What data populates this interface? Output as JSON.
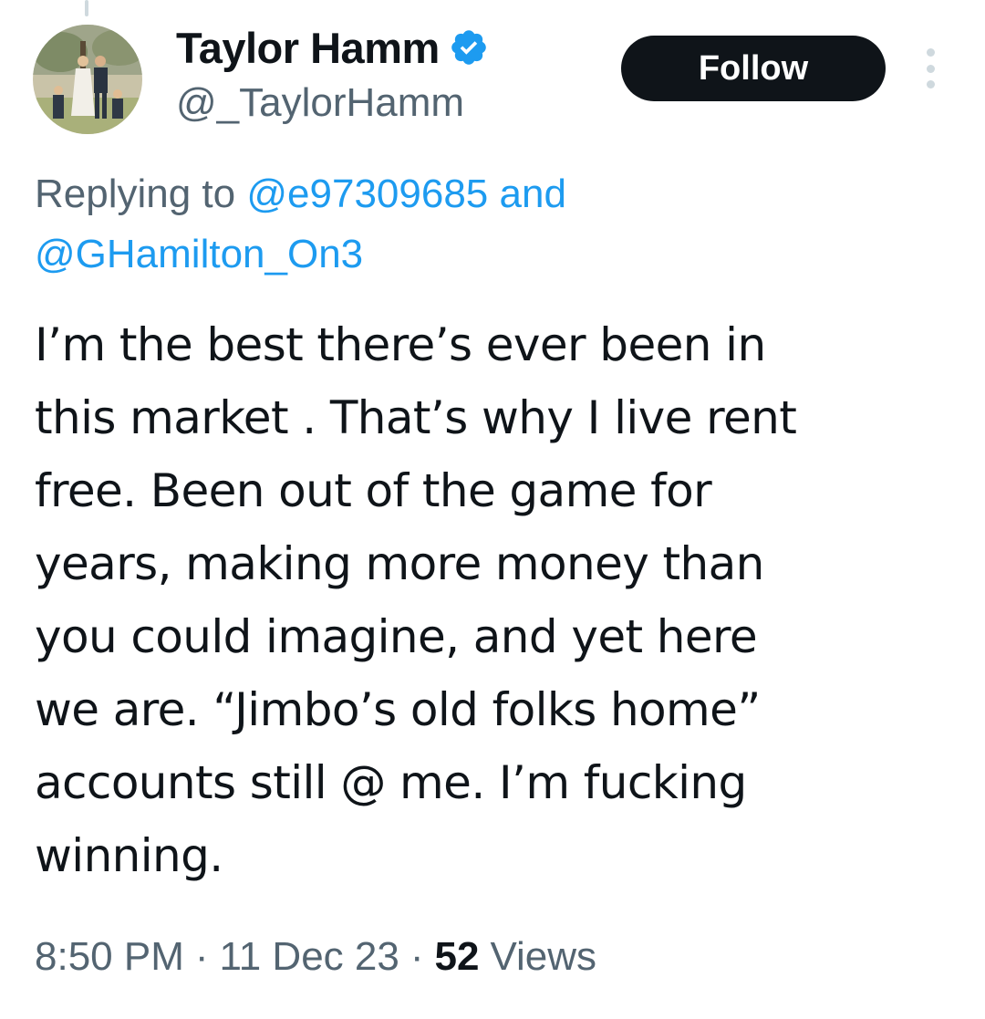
{
  "tweet": {
    "author": {
      "display_name": "Taylor Hamm",
      "handle": "@_TaylorHamm",
      "verified": true
    },
    "follow_label": "Follow",
    "more_icon": "more-vertical-icon",
    "reply": {
      "prefix": "Replying to",
      "mention_1": "@e97309685",
      "conjunction": "and",
      "mention_2": "@GHamilton_On3"
    },
    "text_lines": [
      "I’m the best there’s ever been in",
      "this market . That’s why I live rent",
      "free. Been out of the game for",
      "years, making more money than",
      "you could imagine, and yet here",
      "we are. “Jimbo’s old folks home”",
      "accounts still @ me. I’m fucking",
      "winning."
    ],
    "meta": {
      "time": "8:50 PM",
      "date": "11 Dec 23",
      "separator": "·",
      "views_count": "52",
      "views_label": "Views"
    },
    "colors": {
      "text": "#0f1419",
      "secondary": "#536471",
      "link": "#1d9bf0",
      "follow_bg": "#0f1419",
      "verified": "#1d9bf0"
    }
  }
}
